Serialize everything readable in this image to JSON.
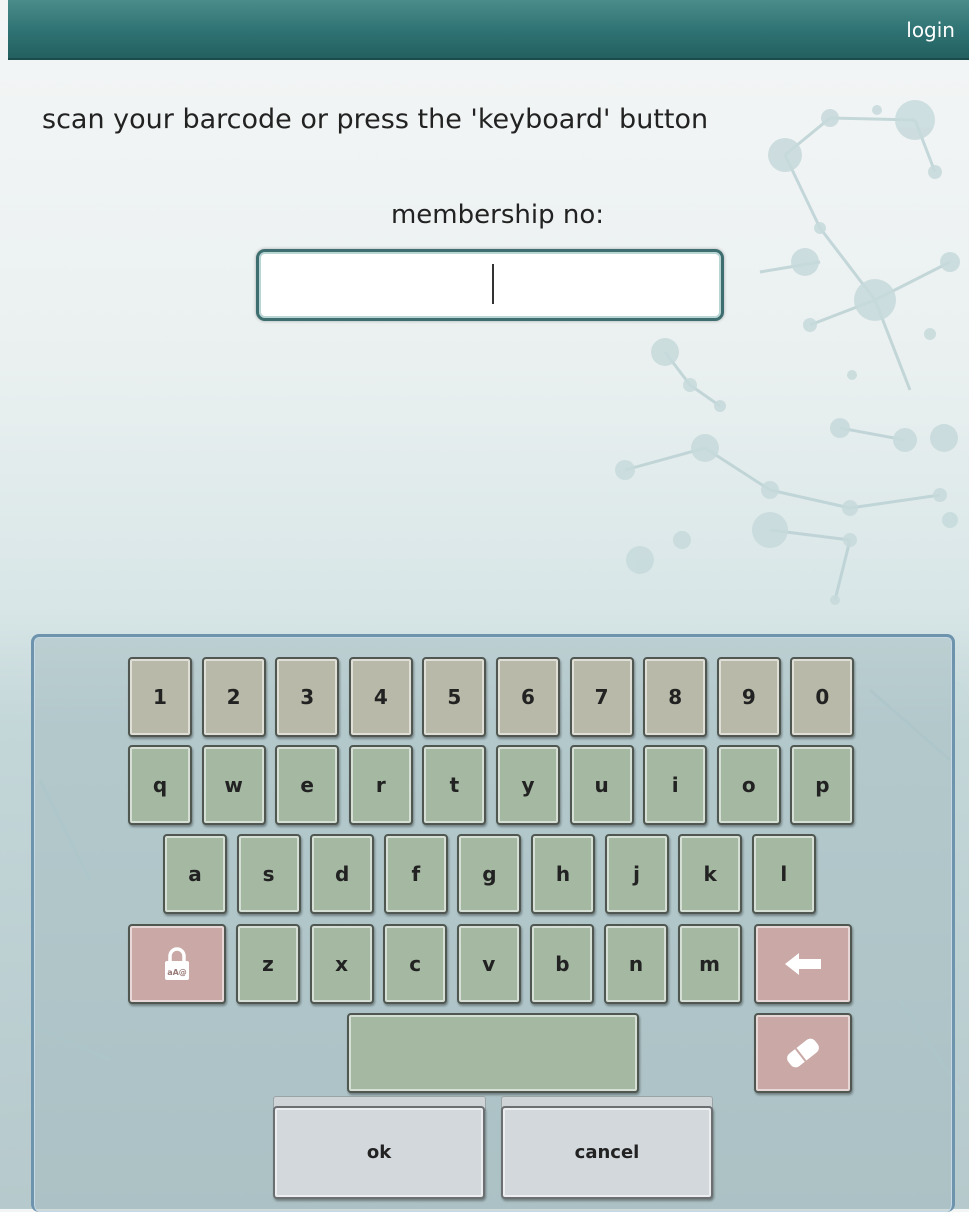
{
  "titlebar": {
    "title": "login"
  },
  "instruction": "scan your barcode or press the 'keyboard' button",
  "field": {
    "label": "membership no:",
    "value": ""
  },
  "keyboard": {
    "row1": [
      "1",
      "2",
      "3",
      "4",
      "5",
      "6",
      "7",
      "8",
      "9",
      "0"
    ],
    "row2": [
      "q",
      "w",
      "e",
      "r",
      "t",
      "y",
      "u",
      "i",
      "o",
      "p"
    ],
    "row3": [
      "a",
      "s",
      "d",
      "f",
      "g",
      "h",
      "j",
      "k",
      "l"
    ],
    "row4": [
      "z",
      "x",
      "c",
      "v",
      "b",
      "n",
      "m"
    ],
    "shift_icon_text": "aA@",
    "icons": {
      "shift": "lock-shift-icon",
      "backspace": "backspace-arrow-icon",
      "clear": "eraser-icon"
    }
  },
  "actions": {
    "ok": "ok",
    "cancel": "cancel"
  },
  "colors": {
    "titlebar": "#2f7273",
    "num_key": "#b9b9a9",
    "letter_key": "#a4b8a2",
    "function_key": "#c9a8a6",
    "action_button": "#d2d8dc"
  }
}
